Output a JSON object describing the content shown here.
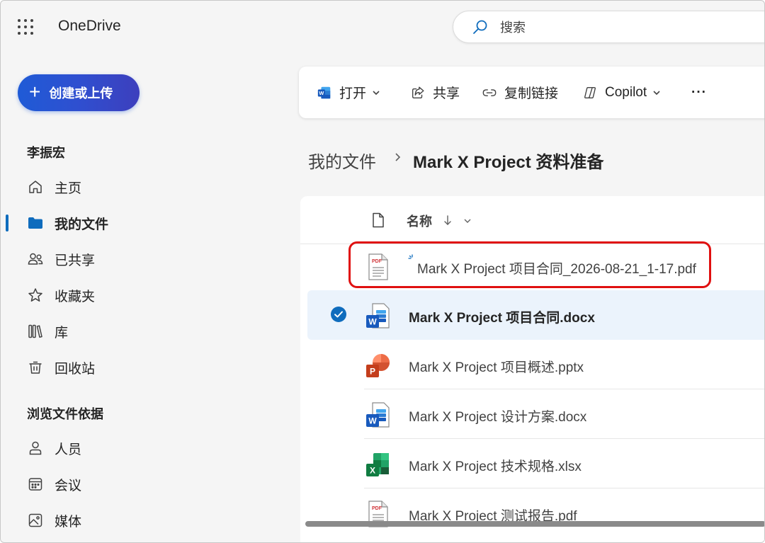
{
  "app": {
    "name": "OneDrive"
  },
  "search": {
    "placeholder": "搜索"
  },
  "create_button": {
    "label": "创建或上传"
  },
  "sidebar": {
    "user_heading": "李振宏",
    "items": [
      {
        "label": "主页",
        "icon": "home-icon"
      },
      {
        "label": "我的文件",
        "icon": "folder-icon",
        "active": true
      },
      {
        "label": "已共享",
        "icon": "people-icon"
      },
      {
        "label": "收藏夹",
        "icon": "star-icon"
      },
      {
        "label": "库",
        "icon": "library-icon"
      },
      {
        "label": "回收站",
        "icon": "trash-icon"
      }
    ],
    "browse_heading": "浏览文件依据",
    "browse_items": [
      {
        "label": "人员",
        "icon": "person-icon"
      },
      {
        "label": "会议",
        "icon": "calendar-icon"
      },
      {
        "label": "媒体",
        "icon": "image-icon"
      }
    ]
  },
  "toolbar": {
    "open_label": "打开",
    "share_label": "共享",
    "copy_link_label": "复制链接",
    "copilot_label": "Copilot",
    "more_label": "···"
  },
  "breadcrumb": {
    "root": "我的文件",
    "current": "Mark X Project 资料准备"
  },
  "file_list": {
    "column_name": "名称",
    "files": [
      {
        "name": "Mark X Project 项目合同_2026-08-21_1-17.pdf",
        "type": "pdf",
        "highlighted": true
      },
      {
        "name": "Mark X Project 项目合同.docx",
        "type": "docx",
        "selected": true
      },
      {
        "name": "Mark X Project 项目概述.pptx",
        "type": "pptx"
      },
      {
        "name": "Mark X Project 设计方案.docx",
        "type": "docx"
      },
      {
        "name": "Mark X Project 技术规格.xlsx",
        "type": "xlsx"
      },
      {
        "name": "Mark X Project 测试报告.pdf",
        "type": "pdf"
      }
    ]
  },
  "colors": {
    "accent": "#0f6cbd",
    "highlight_border": "#e01010",
    "selected_row": "#ebf3fc",
    "word": "#185abd",
    "excel": "#107c41",
    "powerpoint": "#c43e1c",
    "pdf": "#d13438"
  }
}
